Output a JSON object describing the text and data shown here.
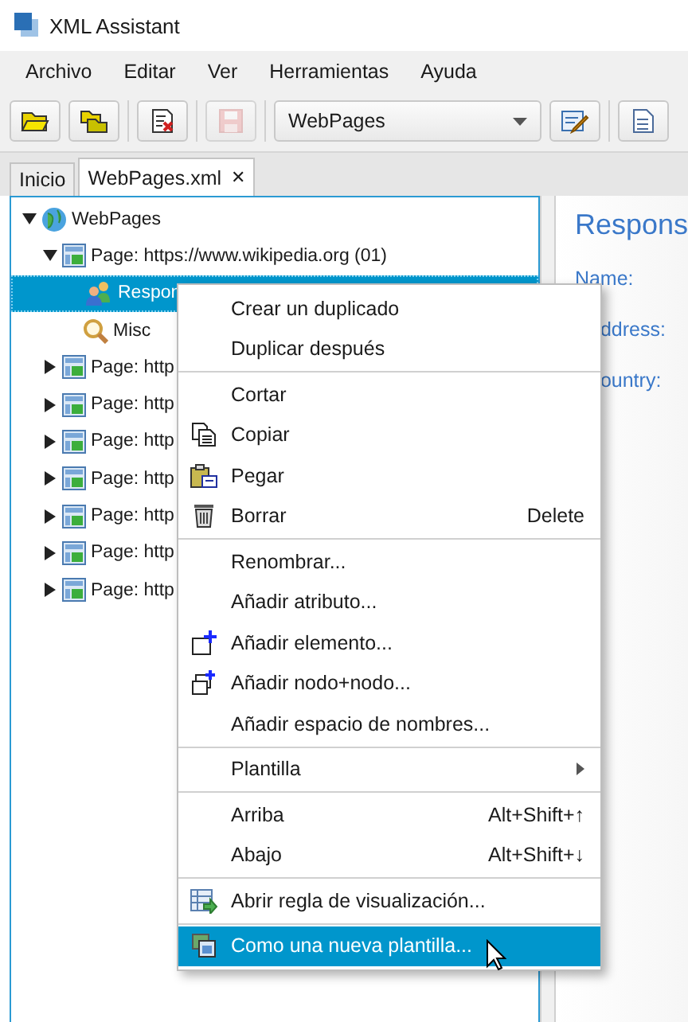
{
  "window": {
    "title": "XML Assistant"
  },
  "menu_bar": [
    "Archivo",
    "Editar",
    "Ver",
    "Herramientas",
    "Ayuda"
  ],
  "toolbar": {
    "buttons": [
      {
        "kind": "open",
        "disabled": false
      },
      {
        "kind": "folder",
        "disabled": false
      },
      {
        "kind": "delete",
        "disabled": false
      },
      {
        "kind": "save",
        "disabled": true
      }
    ],
    "combo": "WebPages",
    "extra": [
      {
        "kind": "edit"
      },
      {
        "kind": "document"
      }
    ]
  },
  "tabs": [
    {
      "label": "Inicio",
      "selected": false
    },
    {
      "label": "WebPages.xml",
      "selected": true,
      "close": "✕"
    }
  ],
  "tree": [
    {
      "label": "WebPages",
      "kind": "globe",
      "expanded": true,
      "selected": false,
      "children": [
        {
          "label": "Page: https://www.wikipedia.org (01)",
          "kind": "page",
          "expanded": true,
          "selected": false,
          "children": [
            {
              "label": "Respon",
              "kind": "people",
              "selected": true
            },
            {
              "label": "Misc",
              "kind": "magnifier",
              "selected": false
            }
          ]
        },
        {
          "label": "Page: http",
          "kind": "page",
          "expanded": false,
          "selected": false
        },
        {
          "label": "Page: http",
          "kind": "page",
          "expanded": false,
          "selected": false
        },
        {
          "label": "Page: http",
          "kind": "page",
          "expanded": false,
          "selected": false
        },
        {
          "label": "Page: http",
          "kind": "page",
          "expanded": false,
          "selected": false
        },
        {
          "label": "Page: http",
          "kind": "page",
          "expanded": false,
          "selected": false
        },
        {
          "label": "Page: http",
          "kind": "page",
          "expanded": false,
          "selected": false
        },
        {
          "label": "Page: http",
          "kind": "page",
          "expanded": false,
          "selected": false
        }
      ]
    }
  ],
  "details": {
    "title": "Respons",
    "fields": [
      {
        "label": "Name:",
        "covered": false
      },
      {
        "label": "ddress:",
        "covered": true
      },
      {
        "label": "ountry:",
        "covered": true
      }
    ]
  },
  "context_menu": [
    [
      {
        "label": "Crear un duplicado",
        "selected": false
      },
      {
        "label": "Duplicar después",
        "selected": false
      }
    ],
    [
      {
        "label": "Cortar",
        "selected": false
      },
      {
        "label": "Copiar",
        "kind": "copy",
        "selected": false
      },
      {
        "label": "Pegar",
        "kind": "paste",
        "selected": false
      },
      {
        "label": "Borrar",
        "kind": "trash",
        "shortcut": "Delete",
        "selected": false
      }
    ],
    [
      {
        "label": "Renombrar...",
        "selected": false
      },
      {
        "label": "Añadir atributo...",
        "selected": false
      },
      {
        "label": "Añadir elemento...",
        "kind": "add-element",
        "selected": false
      },
      {
        "label": "Añadir nodo+nodo...",
        "kind": "add-node",
        "selected": false
      },
      {
        "label": "Añadir espacio de nombres...",
        "selected": false
      }
    ],
    [
      {
        "label": "Plantilla",
        "submenu": true,
        "selected": false
      }
    ],
    [
      {
        "label": "Arriba",
        "shortcut": "Alt+Shift+↑",
        "selected": false
      },
      {
        "label": "Abajo",
        "shortcut": "Alt+Shift+↓",
        "selected": false
      }
    ],
    [
      {
        "label": "Abrir regla de visualización...",
        "kind": "open-rule",
        "selected": false
      }
    ],
    [
      {
        "label": "Como una nueva plantilla...",
        "kind": "template",
        "selected": true
      }
    ]
  ]
}
